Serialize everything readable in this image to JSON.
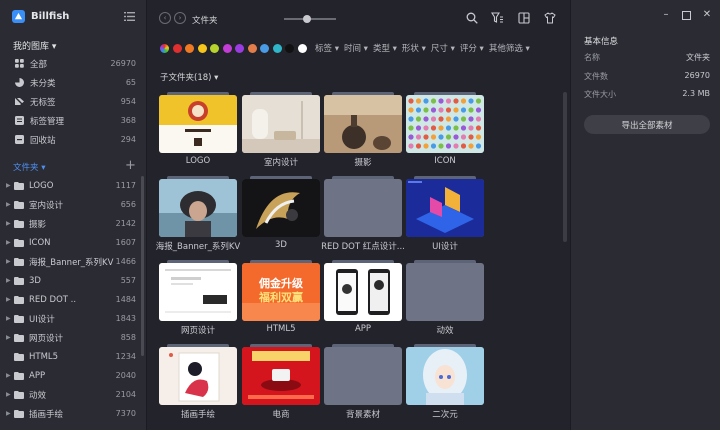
{
  "app": {
    "name": "Billfish"
  },
  "sidebar": {
    "library_title": "我的图库 ▾",
    "library_items": [
      {
        "label": "全部",
        "count": "26970",
        "icon": "grid-icon"
      },
      {
        "label": "未分类",
        "count": "65",
        "icon": "pie-icon"
      },
      {
        "label": "无标签",
        "count": "954",
        "icon": "tag-off-icon"
      },
      {
        "label": "标签管理",
        "count": "368",
        "icon": "tag-manage-icon"
      },
      {
        "label": "回收站",
        "count": "294",
        "icon": "trash-icon"
      }
    ],
    "folders_title": "文件夹 ▾",
    "folders": [
      {
        "label": "LOGO",
        "count": "1117"
      },
      {
        "label": "室内设计",
        "count": "656"
      },
      {
        "label": "摄影",
        "count": "2142"
      },
      {
        "label": "ICON",
        "count": "1607"
      },
      {
        "label": "海报_Banner_系列KV",
        "count": "1466"
      },
      {
        "label": "3D",
        "count": "557"
      },
      {
        "label": "RED DOT ..",
        "count": "1484"
      },
      {
        "label": "UI设计",
        "count": "1843"
      },
      {
        "label": "网页设计",
        "count": "858"
      },
      {
        "label": "HTML5",
        "count": "1234"
      },
      {
        "label": "APP",
        "count": "2040"
      },
      {
        "label": "动效",
        "count": "2104"
      },
      {
        "label": "插画手绘",
        "count": "7370"
      }
    ]
  },
  "toolbar": {
    "back": "‹",
    "forward": "›",
    "breadcrumb": "文件夹",
    "zoom_level": 0.45
  },
  "filters": {
    "colors": [
      "rainbow",
      "#e02f2f",
      "#f07a24",
      "#f5c51c",
      "#b8d42c",
      "#c23cd6",
      "#9a3ce0",
      "#e37d4a",
      "#4a9be6",
      "#2fb6c9",
      "#111111",
      "#ffffff"
    ],
    "menus": [
      "标签 ▾",
      "时间 ▾",
      "类型 ▾",
      "形状 ▾",
      "尺寸 ▾",
      "评分 ▾",
      "其他筛选 ▾"
    ]
  },
  "content": {
    "subfolder_title": "子文件夹(18) ▾",
    "folders": [
      {
        "name": "LOGO",
        "thumb": "logo"
      },
      {
        "name": "室内设计",
        "thumb": "interior"
      },
      {
        "name": "摄影",
        "thumb": "photo"
      },
      {
        "name": "ICON",
        "thumb": "icon"
      },
      {
        "name": "海报_Banner_系列KV",
        "thumb": "poster"
      },
      {
        "name": "3D",
        "thumb": "3d"
      },
      {
        "name": "RED DOT 红点设计...",
        "thumb": "empty"
      },
      {
        "name": "UI设计",
        "thumb": "ui"
      },
      {
        "name": "网页设计",
        "thumb": "web"
      },
      {
        "name": "HTML5",
        "thumb": "html5"
      },
      {
        "name": "APP",
        "thumb": "app"
      },
      {
        "name": "动效",
        "thumb": "empty"
      },
      {
        "name": "插画手绘",
        "thumb": "illus"
      },
      {
        "name": "电商",
        "thumb": "ecom"
      },
      {
        "name": "背景素材",
        "thumb": "empty"
      },
      {
        "name": "二次元",
        "thumb": "anime"
      }
    ],
    "html5_text": "佣金升级 福利双赢"
  },
  "panel": {
    "title": "基本信息",
    "rows": [
      {
        "key": "名称",
        "value": "文件夹"
      },
      {
        "key": "文件数",
        "value": "26970"
      },
      {
        "key": "文件大小",
        "value": "2.3 MB"
      }
    ],
    "export_label": "导出全部素材"
  }
}
